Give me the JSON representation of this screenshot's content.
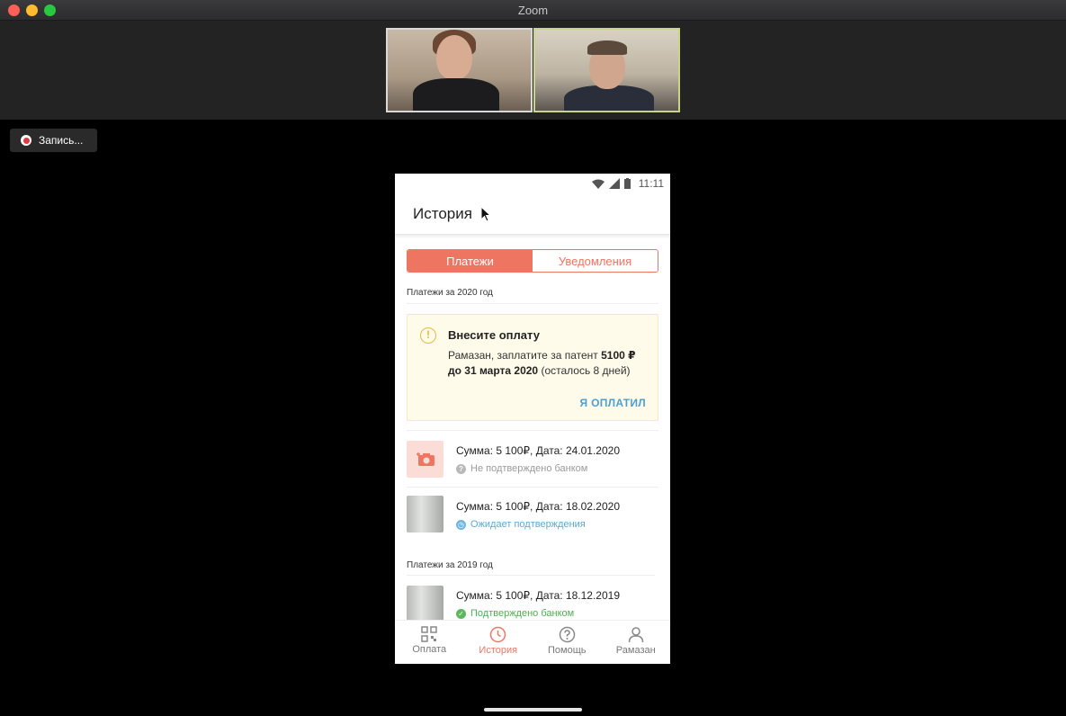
{
  "window": {
    "title": "Zoom"
  },
  "recording": {
    "label": "Запись..."
  },
  "participants": [
    {
      "name": "participant-1"
    },
    {
      "name": "participant-2"
    }
  ],
  "phone": {
    "status": {
      "time": "11:11"
    },
    "appbar": {
      "title": "История"
    },
    "segments": {
      "active": "Платежи",
      "inactive": "Уведомления"
    },
    "sections": {
      "y2020": "Платежи за 2020 год",
      "y2019": "Платежи за 2019 год"
    },
    "notice": {
      "title": "Внесите оплату",
      "text_1": "Рамазан, заплатите за патент ",
      "amount": "5100 ₽",
      "text_2": " ",
      "deadline": "до 31 марта 2020",
      "text_3": " (осталось 8 дней)",
      "action": "Я ОПЛАТИЛ"
    },
    "payments": [
      {
        "summary": "Сумма: 5 100₽,  Дата: 24.01.2020",
        "status": "Не подтверждено банком",
        "state": "grey"
      },
      {
        "summary": "Сумма: 5 100₽,  Дата: 18.02.2020",
        "status": "Ожидает подтверждения",
        "state": "blue"
      },
      {
        "summary": "Сумма: 5 100₽,  Дата: 18.12.2019",
        "status": "Подтверждено банком",
        "state": "green"
      }
    ],
    "tabs": [
      {
        "label": "Оплата",
        "icon": "qr-code-icon"
      },
      {
        "label": "История",
        "icon": "clock-icon"
      },
      {
        "label": "Помощь",
        "icon": "help-icon"
      },
      {
        "label": "Рамазан",
        "icon": "person-icon"
      }
    ],
    "colors": {
      "accent": "#ef7563",
      "link": "#4a9fd4",
      "warning": "#e8b93a"
    }
  }
}
